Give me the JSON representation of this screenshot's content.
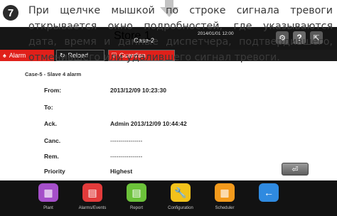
{
  "caption": {
    "step": "7",
    "text": "При щелчке мышкой по строке сигнала тревоги открывается окно подробностей, где указываются дата, время и данные диспетчера, подтвердившего, отменившего или удалившего сигнал тревоги."
  },
  "topbar": {
    "store": "Store 1",
    "case": "Case-2",
    "datetime": "2014/01/01 12:00",
    "tabs": {
      "alarm": "Alarm",
      "reload": "Reload",
      "guardian": "Guardian"
    }
  },
  "detail": {
    "title": "Case-5 - Slave 4 alarm",
    "from_label": "From:",
    "from_value": "2013/12/09 10:23:30",
    "to_label": "To:",
    "to_value": "",
    "ack_label": "Ack.",
    "ack_value": "Admin   2013/12/09 10:44:42",
    "canc_label": "Canc.",
    "canc_value": "----------------",
    "rem_label": "Rem.",
    "rem_value": "----------------",
    "priority_label": "Priority",
    "priority_value": "Highest"
  },
  "nav": {
    "plant": "Plant",
    "alarms": "Alarms/Events",
    "report": "Report",
    "configuration": "Configuration",
    "scheduler": "Scheduler"
  },
  "colors": {
    "alarm_red": "#e0201a",
    "bar_dark": "#161616"
  }
}
